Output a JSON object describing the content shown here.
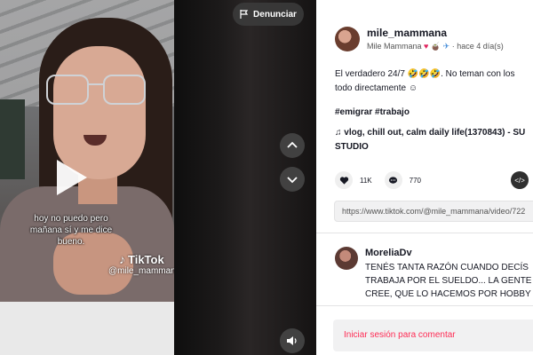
{
  "video": {
    "report_label": "Denunciar",
    "caption_line1": "hoy no puedo pero",
    "caption_line2": "mañana sí y me dice",
    "caption_line3": "bueno.",
    "watermark_brand": "TikTok",
    "watermark_handle": "@mile_mammana",
    "icons": {
      "play": "play-icon",
      "up": "chevron-up-icon",
      "down": "chevron-down-icon",
      "volume": "volume-icon",
      "flag": "flag-icon"
    }
  },
  "post": {
    "username": "mile_mammana",
    "display_name": "Mile Mammana",
    "time_ago": "hace 4 día(s)",
    "description_line1": "El verdadero 24/7 🤣🤣🤣. No teman con los",
    "description_line2": "todo directamente ☺",
    "hashtags": "#emigrar #trabajo",
    "music_line1": "vlog, chill out, calm daily life(1370843) - SU",
    "music_line2": "STUDIO",
    "likes": "11K",
    "comments": "770",
    "link": "https://www.tiktok.com/@mile_mammana/video/722"
  },
  "comments": [
    {
      "user": "MoreliaDv",
      "line1": "TENÉS TANTA RAZÓN CUANDO DECÍS",
      "line2": "TRABAJA POR EL SUELDO... LA GENTE",
      "line3": "CREE, QUE LO HACEMOS POR HOBBY"
    }
  ],
  "login_prompt": "Iniciar sesión para comentar",
  "colors": {
    "accent": "#fe2c55",
    "panel_bg": "#ffffff",
    "text": "#161823"
  }
}
